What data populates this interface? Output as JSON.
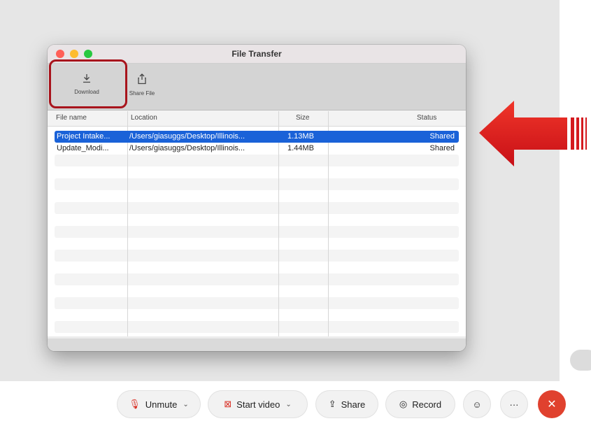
{
  "window": {
    "title": "File Transfer",
    "toolbar": {
      "download_label": "Download",
      "share_label": "Share File"
    },
    "table": {
      "columns": [
        "File name",
        "Location",
        "Size",
        "Status"
      ],
      "rows": [
        {
          "name": "Project Intake...",
          "location": "/Users/giasuggs/Desktop/Illinois...",
          "size": "1.13MB",
          "status": "Shared",
          "selected": true
        },
        {
          "name": "Update_Modi...",
          "location": "/Users/giasuggs/Desktop/Illinois...",
          "size": "1.44MB",
          "status": "Shared",
          "selected": false
        }
      ]
    }
  },
  "controls": {
    "unmute": "Unmute",
    "start_video": "Start video",
    "share": "Share",
    "record": "Record",
    "more": "···",
    "end": "✕"
  },
  "colors": {
    "selection": "#1a62d8",
    "highlight": "#a8141c",
    "arrow": "#e1141b",
    "end_call": "#e0412e"
  }
}
